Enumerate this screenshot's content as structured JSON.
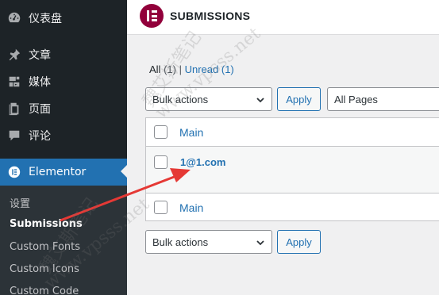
{
  "sidebar": {
    "items": [
      {
        "label": "仪表盘",
        "icon": "dashboard-icon"
      },
      {
        "label": "文章",
        "icon": "pin-icon"
      },
      {
        "label": "媒体",
        "icon": "media-icon"
      },
      {
        "label": "页面",
        "icon": "pages-icon"
      },
      {
        "label": "评论",
        "icon": "comments-icon"
      },
      {
        "label": "Elementor",
        "icon": "elementor-icon"
      }
    ],
    "submenu": [
      "设置",
      "Submissions",
      "Custom Fonts",
      "Custom Icons",
      "Custom Code"
    ]
  },
  "header": {
    "title": "SUBMISSIONS"
  },
  "views": {
    "all_label": "All",
    "all_count": "(1)",
    "separator": "|",
    "unread_label": "Unread",
    "unread_count": "(1)"
  },
  "bulk_top": {
    "select": "Bulk actions",
    "apply": "Apply"
  },
  "filter": {
    "pages": "All Pages"
  },
  "table": {
    "header_col": "Main",
    "rows": [
      {
        "email": "1@1.com"
      }
    ],
    "footer_col": "Main"
  },
  "bulk_bottom": {
    "select": "Bulk actions",
    "apply": "Apply"
  },
  "watermarks": [
    "魏艾斯笔记",
    "www.vpsss.net",
    "魏艾斯笔记",
    "www.vpsss.net"
  ],
  "colors": {
    "sidebar": "#1d2327",
    "active": "#2271b1",
    "brand": "#92003b",
    "annotation": "#e53935"
  }
}
